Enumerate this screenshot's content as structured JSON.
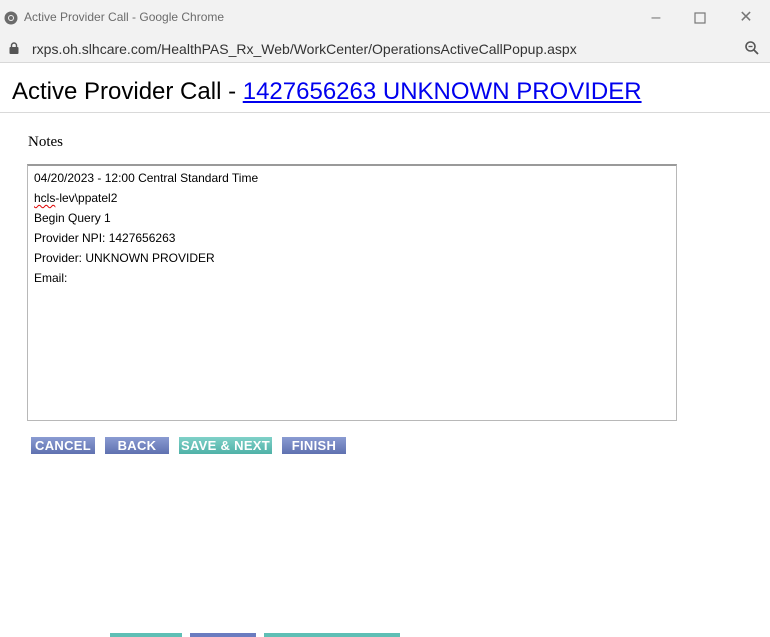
{
  "window": {
    "title": "Active Provider Call - Google Chrome",
    "url": "rxps.oh.slhcare.com/HealthPAS_Rx_Web/WorkCenter/OperationsActiveCallPopup.aspx"
  },
  "page": {
    "heading_prefix": "Active Provider Call - ",
    "heading_link": "1427656263 UNKNOWN PROVIDER",
    "notes_label": "Notes"
  },
  "notes": {
    "lines": [
      "04/20/2023 - 12:00 Central Standard Time",
      "Begin Query 1",
      "Provider NPI: 1427656263",
      "Provider: UNKNOWN PROVIDER",
      "Email:"
    ],
    "user_prefix": "hcls",
    "user_rest": "-lev\\ppatel2"
  },
  "buttons": {
    "cancel": "CANCEL",
    "back": "BACK",
    "save_next": "SAVE & NEXT",
    "finish": "FINISH"
  },
  "colors": {
    "button_blue": "#6b7cc0",
    "button_teal": "#5fbfb5",
    "link": "#0000ee"
  }
}
